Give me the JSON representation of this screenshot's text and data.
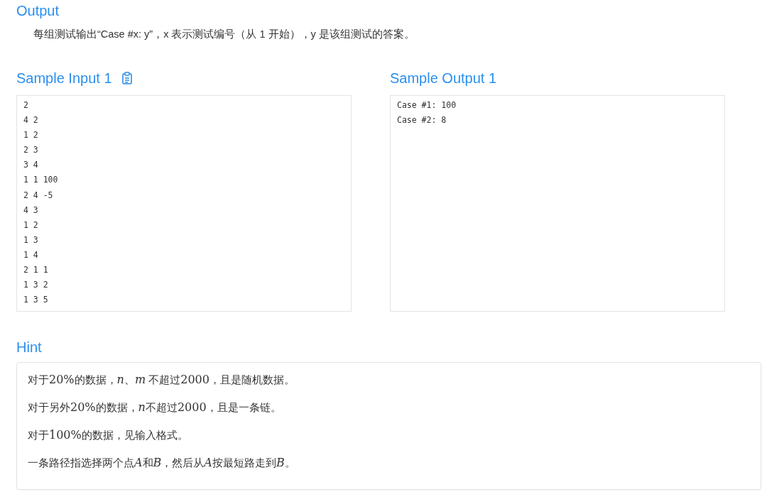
{
  "output": {
    "title": "Output",
    "text": "每组测试输出“Case #x: y”，x 表示测试编号（从 1 开始），y 是该组测试的答案。"
  },
  "samples": [
    {
      "title": "Sample Input 1",
      "copy_icon": true,
      "lines": [
        "2",
        "4 2",
        "1 2",
        "2 3",
        "3 4",
        "1 1 100",
        "2 4 -5",
        "4 3",
        "1 2",
        "1 3",
        "1 4",
        "2 1 1",
        "1 3 2",
        "1 3 5"
      ]
    },
    {
      "title": "Sample Output 1",
      "copy_icon": false,
      "lines": [
        "Case #1: 100",
        "Case #2: 8"
      ]
    }
  ],
  "hint": {
    "title": "Hint",
    "paragraphs": [
      [
        {
          "kind": "text",
          "text": "对于"
        },
        {
          "kind": "num",
          "text": "20%"
        },
        {
          "kind": "text",
          "text": "的数据，"
        },
        {
          "kind": "var",
          "text": "n"
        },
        {
          "kind": "text",
          "text": "、"
        },
        {
          "kind": "var",
          "text": "m"
        },
        {
          "kind": "text",
          "text": " 不超过"
        },
        {
          "kind": "num",
          "text": "2000"
        },
        {
          "kind": "text",
          "text": "，且是随机数据。"
        }
      ],
      [
        {
          "kind": "text",
          "text": "对于另外"
        },
        {
          "kind": "num",
          "text": "20%"
        },
        {
          "kind": "text",
          "text": "的数据，"
        },
        {
          "kind": "var",
          "text": "n"
        },
        {
          "kind": "text",
          "text": "不超过"
        },
        {
          "kind": "num",
          "text": "2000"
        },
        {
          "kind": "text",
          "text": "，且是一条链。"
        }
      ],
      [
        {
          "kind": "text",
          "text": "对于"
        },
        {
          "kind": "num",
          "text": "100%"
        },
        {
          "kind": "text",
          "text": "的数据，见输入格式。"
        }
      ],
      [
        {
          "kind": "text",
          "text": "一条路径指选择两个点"
        },
        {
          "kind": "var",
          "text": "A"
        },
        {
          "kind": "text",
          "text": "和"
        },
        {
          "kind": "var",
          "text": "B"
        },
        {
          "kind": "text",
          "text": "，然后从"
        },
        {
          "kind": "var",
          "text": "A"
        },
        {
          "kind": "text",
          "text": "按最短路走到"
        },
        {
          "kind": "var",
          "text": "B"
        },
        {
          "kind": "text",
          "text": "。"
        }
      ]
    ]
  }
}
